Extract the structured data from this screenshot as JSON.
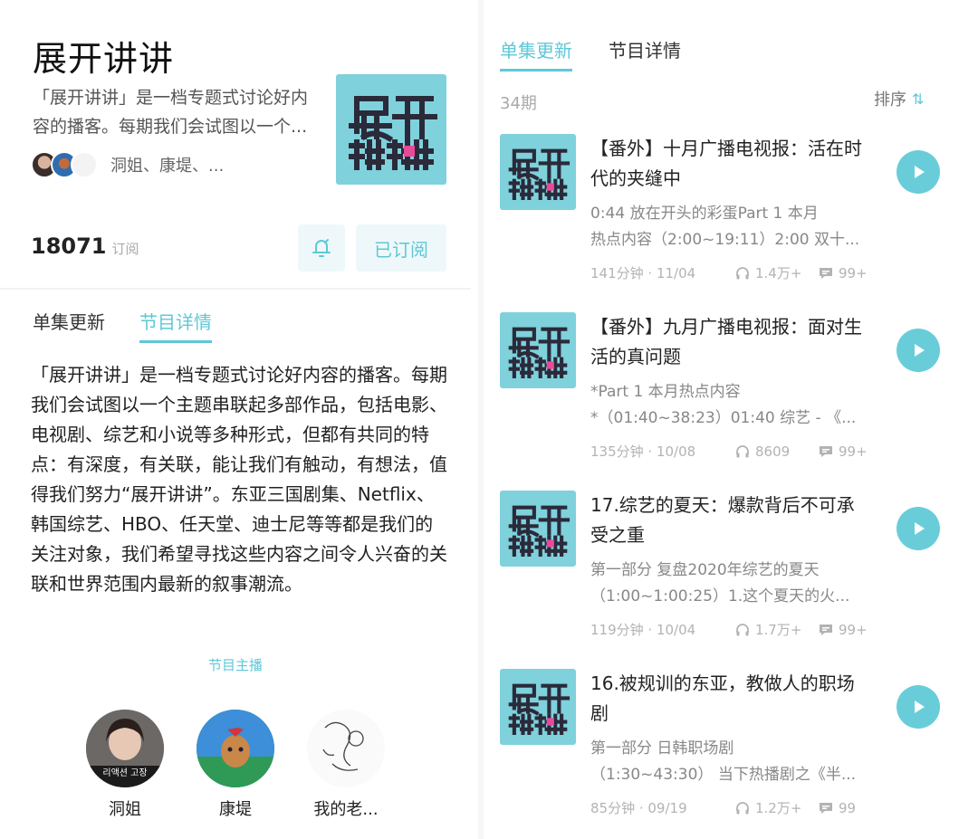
{
  "podcast": {
    "title": "展开讲讲",
    "short_desc_line1": "「展开讲讲」是一档专题式讨论好内",
    "short_desc_line2": "容的播客。每期我们会试图以一个...",
    "hosts_preview": "洞姐、康堤、...",
    "subscribers": "18071",
    "subscribers_label": "订阅",
    "subscribed_label": "已订阅"
  },
  "left_tabs": [
    {
      "label": "单集更新",
      "active": false
    },
    {
      "label": "节目详情",
      "active": true
    }
  ],
  "detail_text": "「展开讲讲」是一档专题式讨论好内容的播客。每期我们会试图以一个主题串联起多部作品，包括电影、电视剧、综艺和小说等多种形式，但都有共同的特点：有深度，有关联，能让我们有触动，有想法，值得我们努力“展开讲讲”。东亚三国剧集、Netflix、韩国综艺、HBO、任天堂、迪士尼等等都是我们的关注对象，我们希望寻找这些内容之间令人兴奋的关联和世界范围内最新的叙事潮流。",
  "hosts_heading": "节目主播",
  "hosts": [
    {
      "name": "洞姐"
    },
    {
      "name": "康堤"
    },
    {
      "name": "我的老..."
    }
  ],
  "right_tabs": [
    {
      "label": "单集更新",
      "active": true
    },
    {
      "label": "节目详情",
      "active": false
    }
  ],
  "episode_count": "34期",
  "sort_label": "排序",
  "episodes": [
    {
      "title": "【番外】十月广播电视报：活在时代的夹缝中",
      "desc_line1": "0:44 放在开头的彩蛋Part 1 本月",
      "desc_line2": "热点内容（2:00~19:11）2:00 双十...",
      "duration_date": "141分钟 · 11/04",
      "plays": "1.4万+",
      "comments": "99+"
    },
    {
      "title": "【番外】九月广播电视报：面对生活的真问题",
      "desc_line1": "*Part 1 本月热点内容",
      "desc_line2": "*（01:40~38:23）01:40 综艺 - 《...",
      "duration_date": "135分钟 · 10/08",
      "plays": "8609",
      "comments": "99+"
    },
    {
      "title": "17.综艺的夏天：爆款背后不可承受之重",
      "desc_line1": "第一部分 复盘2020年综艺的夏天",
      "desc_line2": "（1:00~1:00:25）1.这个夏天的火...",
      "duration_date": "119分钟 · 10/04",
      "plays": "1.7万+",
      "comments": "99+"
    },
    {
      "title": "16.被规训的东亚，教做人的职场剧",
      "desc_line1": "第一部分 日韩职场剧",
      "desc_line2": "（1:30~43:30） 当下热播剧之《半...",
      "duration_date": "85分钟 · 09/19",
      "plays": "1.2万+",
      "comments": "99"
    }
  ],
  "colors": {
    "accent": "#5ec8d7",
    "cover_bg": "#7fd1dc",
    "cover_text": "#2a2a3a",
    "cover_highlight": "#e84a9a"
  },
  "icons": [
    "bell-icon",
    "sort-icon",
    "headphones-icon",
    "comment-icon",
    "play-icon"
  ]
}
